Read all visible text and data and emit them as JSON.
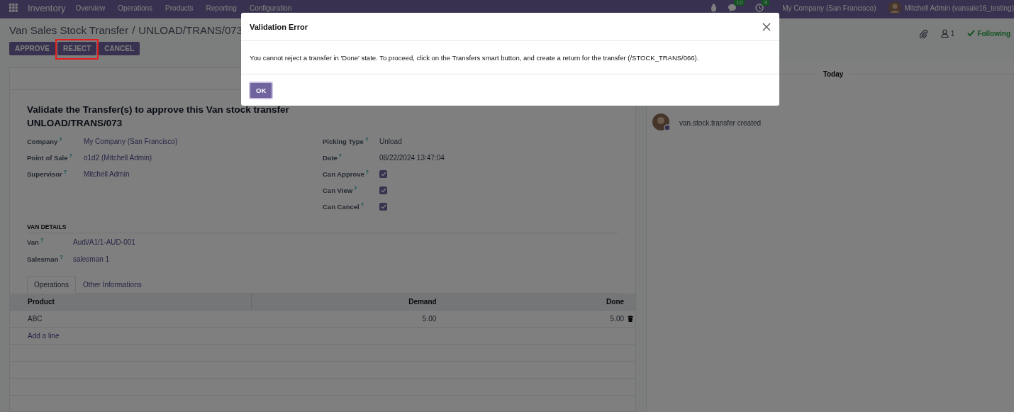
{
  "navbar": {
    "app": "Inventory",
    "menus": [
      "Overview",
      "Operations",
      "Products",
      "Reporting",
      "Configuration"
    ],
    "chat_count": "10",
    "activity_count": "3",
    "company": "My Company (San Francisco)",
    "user": "Mitchell Admin (vansale16_testing)"
  },
  "breadcrumb": {
    "parent": "Van Sales Stock Transfer",
    "separator": "/",
    "current": "UNLOAD/TRANS/073"
  },
  "actions": [
    {
      "label": "APPROVE",
      "highlighted": false
    },
    {
      "label": "REJECT",
      "highlighted": true
    },
    {
      "label": "CANCEL",
      "highlighted": false
    }
  ],
  "chatter": {
    "followers": "1",
    "follow_label": "Following",
    "date_separator": "Today",
    "messages": [
      {
        "text": "van.stock.transfer created"
      }
    ]
  },
  "form": {
    "title": "Validate the Transfer(s) to approve this Van stock transfer UNLOAD/TRANS/073",
    "left_fields": [
      {
        "label": "Company",
        "help": "?",
        "kind": "link",
        "value": "My Company (San Francisco)"
      },
      {
        "label": "Point of Sale",
        "help": "?",
        "kind": "link",
        "value": "o1d2 (Mitchell Admin)"
      },
      {
        "label": "Supervisor",
        "help": "?",
        "kind": "link",
        "value": "Mitchell Admin"
      }
    ],
    "right_fields": [
      {
        "label": "Picking Type",
        "help": "?",
        "kind": "text",
        "value": "Unload"
      },
      {
        "label": "Date",
        "help": "?",
        "kind": "text",
        "value": "08/22/2024 13:47:04"
      },
      {
        "label": "Can Approve",
        "help": "?",
        "kind": "checkbox",
        "checked": true
      },
      {
        "label": "Can View",
        "help": "?",
        "kind": "checkbox",
        "checked": true
      },
      {
        "label": "Can Cancel",
        "help": "?",
        "kind": "checkbox",
        "checked": true
      }
    ],
    "van_section": {
      "title": "VAN DETAILS",
      "fields": [
        {
          "label": "Van",
          "help": "?",
          "kind": "link",
          "value": "Audi/A1/1-AUD-001"
        },
        {
          "label": "Salesman",
          "help": "?",
          "kind": "link",
          "value": "salesman 1"
        }
      ]
    },
    "tabs": [
      {
        "label": "Operations",
        "selected": true
      },
      {
        "label": "Other Informations",
        "selected": false
      }
    ],
    "table": {
      "columns": [
        "Product",
        "Demand",
        "Done"
      ],
      "rows": [
        {
          "product": "ABC",
          "demand": "5.00",
          "done": "5.00"
        }
      ],
      "add_line": "Add a line"
    }
  },
  "dialog": {
    "title": "Validation Error",
    "message": "You cannot reject a transfer in 'Done' state. To proceed, click on the Transfers smart button, and create a return for the transfer (/STOCK_TRANS/066).",
    "button": "OK"
  }
}
